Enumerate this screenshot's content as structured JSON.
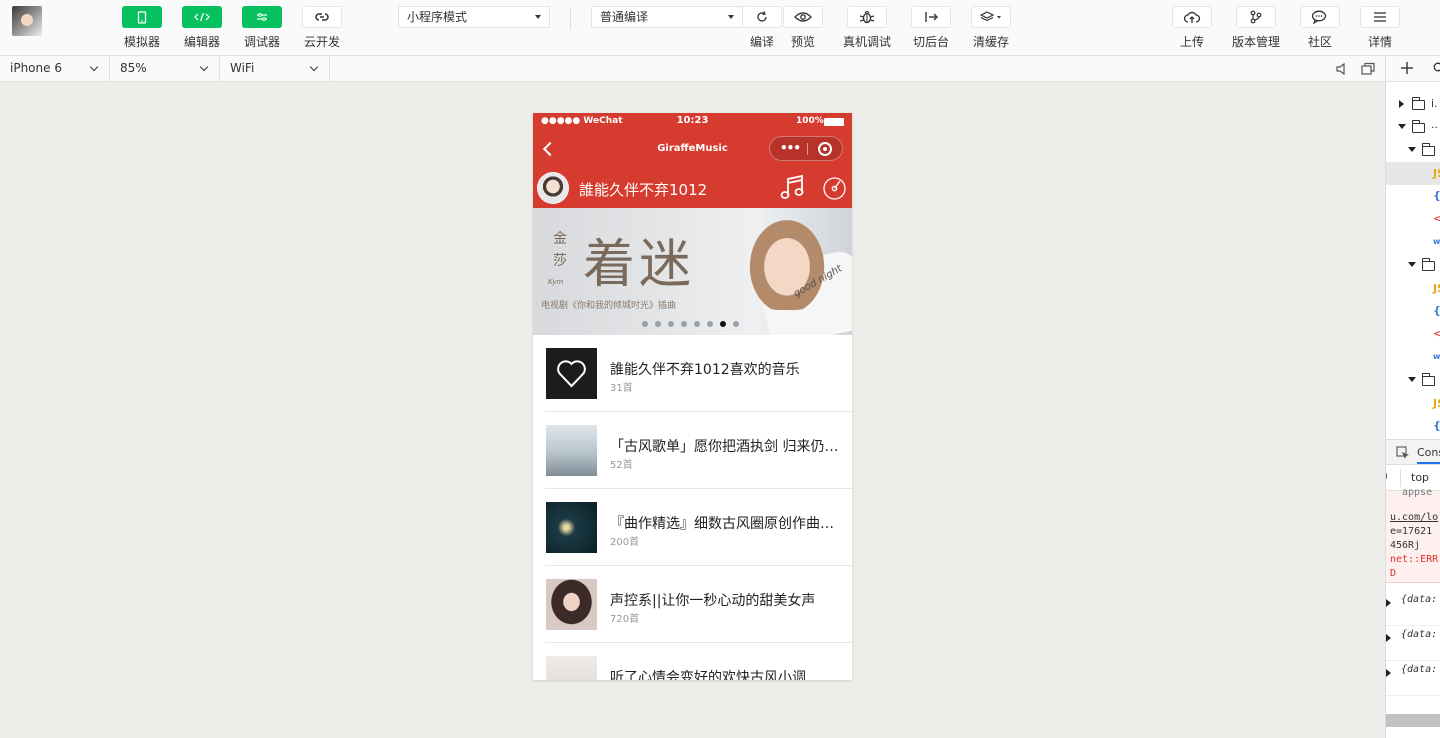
{
  "toolbar": {
    "left_buttons": [
      {
        "label": "模拟器",
        "icon": "phone-icon"
      },
      {
        "label": "编辑器",
        "icon": "code-icon"
      },
      {
        "label": "调试器",
        "icon": "debug-icon"
      },
      {
        "label": "云开发",
        "icon": "cloud-link-icon"
      }
    ],
    "mode_select": "小程序模式",
    "compile_select": "普通编译",
    "mid_buttons": [
      {
        "label": "编译",
        "icon": "refresh-icon"
      },
      {
        "label": "预览",
        "icon": "eye-icon"
      },
      {
        "label": "真机调试",
        "icon": "bug-icon"
      },
      {
        "label": "切后台",
        "icon": "switch-icon"
      },
      {
        "label": "清缓存",
        "icon": "layers-icon"
      }
    ],
    "right_buttons": [
      {
        "label": "上传",
        "icon": "upload-cloud-icon"
      },
      {
        "label": "版本管理",
        "icon": "branch-icon"
      },
      {
        "label": "社区",
        "icon": "chat-icon"
      },
      {
        "label": "详情",
        "icon": "menu-icon"
      }
    ],
    "accent": "#07c160"
  },
  "devbar": {
    "device": "iPhone 6",
    "zoom": "85%",
    "network": "WiFi"
  },
  "phone": {
    "status": {
      "carrier": "●●●●● WeChat",
      "time": "10:23",
      "battery": "100%"
    },
    "nav_title": "GiraffeMusic",
    "capsule_dots": "•••",
    "user_name": "誰能久伴不弃1012",
    "theme_color": "#d63b30",
    "banner": {
      "big_text": "着迷",
      "vertical_text": "金莎",
      "artist_en": "Kym",
      "subtitle": "电视剧《你和我的倾城时光》插曲",
      "doodle": "good night",
      "page_count": 8,
      "active_page": 6
    },
    "playlists": [
      {
        "title": "誰能久伴不弃1012喜欢的音乐",
        "count": "31首"
      },
      {
        "title": "「古风歌单」愿你把酒执剑 归来仍是少年",
        "count": "52首"
      },
      {
        "title": "『曲作精选』细数古风圈原创作曲人的优秀作品",
        "count": "200首"
      },
      {
        "title": "声控系||让你一秒心动的甜美女声",
        "count": "720首"
      },
      {
        "title": "听了心情会变好的欢快古风小调",
        "count": ""
      }
    ]
  },
  "rpanel": {
    "tree_labels": [
      "i.",
      "..",
      "JS",
      "{",
      "<",
      "wx"
    ],
    "console_tab": "Cons",
    "console_context": "top",
    "error_lines": [
      "appse",
      "u.com/lo",
      "e=17621",
      "456Rj",
      "net::ERR",
      "D"
    ],
    "log_entries": [
      "{data:",
      "{data:",
      "{data:"
    ]
  }
}
